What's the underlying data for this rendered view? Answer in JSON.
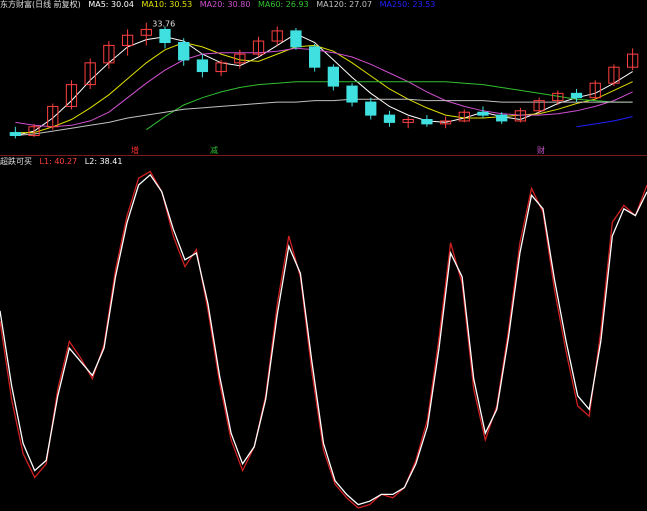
{
  "top_panel": {
    "title": "东方财富(日线 前复权)",
    "ma_labels": [
      {
        "text": "MA5: 30.04",
        "color": "#ffffff"
      },
      {
        "text": "MA10: 30.53",
        "color": "#e0e000"
      },
      {
        "text": "MA20: 30.80",
        "color": "#d050d0"
      },
      {
        "text": "MA60: 26.93",
        "color": "#30c030"
      },
      {
        "text": "MA120: 27.07",
        "color": "#c0c0c0"
      },
      {
        "text": "MA250: 23.53",
        "color": "#2020ff"
      }
    ],
    "annotation": "33.76",
    "markers": [
      {
        "text": "增",
        "color": "#ff3030"
      },
      {
        "text": "减",
        "color": "#30c030"
      },
      {
        "text": "财",
        "color": "#d050d0"
      }
    ]
  },
  "bottom_panel": {
    "title": "超跌可买",
    "l1_label": "L1: 40.27",
    "l2_label": "L2: 38.41"
  },
  "colors": {
    "up_candle": "#ff4040",
    "down_candle": "#40e0e0",
    "l1_line": "#d02020",
    "l2_line": "#ffffff"
  },
  "chart_data": [
    {
      "type": "candlestick",
      "title": "东方财富(日线 前复权)",
      "series": [
        {
          "name": "MA5",
          "color": "#ffffff",
          "values": [
            26.0,
            26.3,
            27.2,
            28.4,
            29.8,
            31.0,
            32.1,
            32.6,
            32.8,
            32.5,
            31.6,
            31.0,
            30.8,
            31.4,
            32.2,
            33.0,
            32.4,
            31.2,
            30.0,
            28.9,
            28.0,
            27.4,
            27.0,
            26.9,
            27.2,
            27.6,
            27.3,
            27.1,
            27.6,
            28.2,
            28.6,
            28.9,
            29.6,
            30.4
          ]
        },
        {
          "name": "MA10",
          "color": "#e0e000",
          "values": [
            26.2,
            26.2,
            26.6,
            27.1,
            27.9,
            28.8,
            29.9,
            31.0,
            31.9,
            32.4,
            32.1,
            31.6,
            31.2,
            31.1,
            31.6,
            32.1,
            32.2,
            31.8,
            31.0,
            30.1,
            29.2,
            28.5,
            27.9,
            27.4,
            27.2,
            27.2,
            27.3,
            27.4,
            27.5,
            27.8,
            28.2,
            28.5,
            29.1,
            29.7
          ]
        },
        {
          "name": "MA20",
          "color": "#d050d0",
          "values": [
            26.9,
            26.7,
            26.6,
            26.7,
            27.0,
            27.6,
            28.6,
            29.6,
            30.5,
            31.2,
            31.6,
            31.7,
            31.7,
            31.7,
            31.8,
            32.0,
            31.9,
            31.7,
            31.4,
            30.9,
            30.3,
            29.7,
            29.0,
            28.4,
            28.0,
            27.7,
            27.5,
            27.4,
            27.4,
            27.5,
            27.7,
            28.0,
            28.4,
            29.0
          ]
        },
        {
          "name": "MA60",
          "color": "#30c030",
          "values": [
            null,
            null,
            null,
            null,
            null,
            null,
            null,
            26.4,
            27.3,
            28.1,
            28.6,
            29.0,
            29.3,
            29.5,
            29.6,
            29.7,
            29.7,
            29.7,
            29.7,
            29.7,
            29.7,
            29.7,
            29.7,
            29.7,
            29.6,
            29.5,
            29.3,
            29.1,
            28.9,
            28.7,
            28.5,
            28.4,
            28.3,
            28.3
          ]
        },
        {
          "name": "MA120",
          "color": "#c0c0c0",
          "values": [
            26.0,
            26.1,
            26.3,
            26.5,
            26.7,
            26.9,
            27.2,
            27.4,
            27.6,
            27.8,
            27.9,
            28.0,
            28.1,
            28.2,
            28.3,
            28.3,
            28.4,
            28.4,
            28.5,
            28.5,
            28.5,
            28.5,
            28.4,
            28.4,
            28.4,
            28.4,
            28.3,
            28.3,
            28.3,
            28.3,
            28.3,
            28.3,
            28.3,
            28.3
          ]
        },
        {
          "name": "MA250",
          "color": "#2020ff",
          "values": [
            null,
            null,
            null,
            null,
            null,
            null,
            null,
            null,
            null,
            null,
            null,
            null,
            null,
            null,
            null,
            null,
            null,
            null,
            null,
            null,
            null,
            null,
            null,
            null,
            null,
            null,
            null,
            null,
            null,
            null,
            26.6,
            26.8,
            27.0,
            27.3
          ]
        }
      ],
      "ohlc": [
        {
          "o": 26.2,
          "h": 26.6,
          "l": 25.8,
          "c": 26.0
        },
        {
          "o": 26.0,
          "h": 26.8,
          "l": 25.9,
          "c": 26.6
        },
        {
          "o": 26.6,
          "h": 28.2,
          "l": 26.4,
          "c": 28.0
        },
        {
          "o": 28.0,
          "h": 29.8,
          "l": 27.8,
          "c": 29.5
        },
        {
          "o": 29.5,
          "h": 31.3,
          "l": 29.2,
          "c": 31.0
        },
        {
          "o": 31.0,
          "h": 32.5,
          "l": 30.6,
          "c": 32.2
        },
        {
          "o": 32.2,
          "h": 33.3,
          "l": 31.5,
          "c": 32.9
        },
        {
          "o": 32.9,
          "h": 33.76,
          "l": 32.2,
          "c": 33.3
        },
        {
          "o": 33.3,
          "h": 33.5,
          "l": 32.0,
          "c": 32.4
        },
        {
          "o": 32.4,
          "h": 32.7,
          "l": 30.8,
          "c": 31.2
        },
        {
          "o": 31.2,
          "h": 31.6,
          "l": 30.0,
          "c": 30.4
        },
        {
          "o": 30.4,
          "h": 31.2,
          "l": 30.1,
          "c": 31.0
        },
        {
          "o": 31.0,
          "h": 31.9,
          "l": 30.6,
          "c": 31.6
        },
        {
          "o": 31.6,
          "h": 32.8,
          "l": 31.4,
          "c": 32.5
        },
        {
          "o": 32.5,
          "h": 33.5,
          "l": 32.2,
          "c": 33.2
        },
        {
          "o": 33.2,
          "h": 33.4,
          "l": 31.9,
          "c": 32.1
        },
        {
          "o": 32.1,
          "h": 32.3,
          "l": 30.4,
          "c": 30.7
        },
        {
          "o": 30.7,
          "h": 30.9,
          "l": 29.1,
          "c": 29.4
        },
        {
          "o": 29.4,
          "h": 29.6,
          "l": 28.0,
          "c": 28.3
        },
        {
          "o": 28.3,
          "h": 28.6,
          "l": 27.1,
          "c": 27.4
        },
        {
          "o": 27.4,
          "h": 27.7,
          "l": 26.6,
          "c": 26.9
        },
        {
          "o": 26.9,
          "h": 27.3,
          "l": 26.5,
          "c": 27.1
        },
        {
          "o": 27.1,
          "h": 27.4,
          "l": 26.6,
          "c": 26.8
        },
        {
          "o": 26.8,
          "h": 27.3,
          "l": 26.5,
          "c": 27.0
        },
        {
          "o": 27.0,
          "h": 27.8,
          "l": 26.9,
          "c": 27.6
        },
        {
          "o": 27.6,
          "h": 28.0,
          "l": 27.2,
          "c": 27.4
        },
        {
          "o": 27.4,
          "h": 27.6,
          "l": 26.8,
          "c": 27.0
        },
        {
          "o": 27.0,
          "h": 27.9,
          "l": 26.9,
          "c": 27.7
        },
        {
          "o": 27.7,
          "h": 28.6,
          "l": 27.5,
          "c": 28.4
        },
        {
          "o": 28.4,
          "h": 29.1,
          "l": 28.1,
          "c": 28.9
        },
        {
          "o": 28.9,
          "h": 29.2,
          "l": 28.3,
          "c": 28.6
        },
        {
          "o": 28.6,
          "h": 29.8,
          "l": 28.5,
          "c": 29.6
        },
        {
          "o": 29.6,
          "h": 30.9,
          "l": 29.4,
          "c": 30.7
        },
        {
          "o": 30.7,
          "h": 32.0,
          "l": 30.5,
          "c": 31.6
        }
      ],
      "ylim": [
        25.0,
        34.5
      ]
    },
    {
      "type": "line",
      "title": "超跌可买",
      "series": [
        {
          "name": "L1",
          "color": "#d02020",
          "values": [
            55,
            32,
            16,
            9,
            13,
            35,
            49,
            44,
            38,
            48,
            70,
            86,
            97,
            99,
            93,
            80,
            71,
            76,
            58,
            37,
            20,
            11,
            18,
            33,
            60,
            80,
            68,
            40,
            17,
            7,
            3,
            0,
            1,
            4,
            3,
            6,
            14,
            26,
            50,
            78,
            66,
            35,
            20,
            30,
            52,
            78,
            94,
            87,
            64,
            46,
            30,
            27,
            52,
            84,
            89,
            86,
            95
          ]
        },
        {
          "name": "L2",
          "color": "#ffffff",
          "values": [
            58,
            36,
            19,
            11,
            14,
            33,
            47,
            43,
            39,
            47,
            68,
            84,
            95,
            98,
            93,
            82,
            73,
            75,
            60,
            39,
            22,
            13,
            18,
            32,
            57,
            77,
            69,
            43,
            19,
            8,
            4,
            1,
            2,
            4,
            4,
            6,
            13,
            24,
            47,
            75,
            68,
            38,
            22,
            29,
            50,
            75,
            92,
            88,
            67,
            49,
            33,
            29,
            49,
            80,
            88,
            86,
            93
          ]
        }
      ],
      "ylim": [
        0,
        100
      ]
    }
  ]
}
